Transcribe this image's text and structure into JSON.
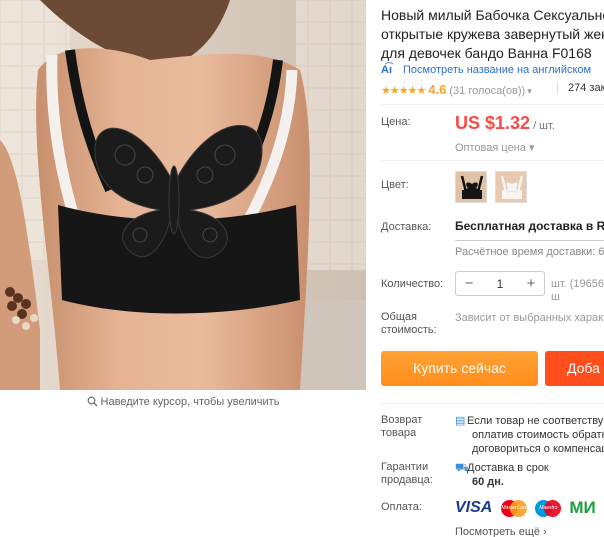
{
  "gallery": {
    "zoom_hint": "Наведите курсор, чтобы увеличить"
  },
  "product": {
    "title_lines": [
      "Новый милый Бабочка Сексуальное",
      "открытые кружева завернутый женс",
      "для девочек бандо Ванна F0168"
    ],
    "translate_link": "Посмотреть название на английском",
    "rating_stars": "★★★★★",
    "rating_value": "4.6",
    "votes": "(31 голоса(ов))",
    "orders": "274 зака"
  },
  "price": {
    "label": "Цена:",
    "value": "US $1.32",
    "unit": "/ шт.",
    "wholesale_link": "Оптовая цена ▾"
  },
  "color": {
    "label": "Цвет:"
  },
  "shipping": {
    "label": "Доставка:",
    "value": "Бесплатная доставка в Russi",
    "time": "Расчётное время доставки: 60"
  },
  "quantity": {
    "label": "Количество:",
    "minus": "−",
    "value": "1",
    "plus": "+",
    "note": "шт. (19656 ш"
  },
  "total": {
    "label_lines": [
      "Общая",
      "стоимость:"
    ],
    "value": "Зависит от выбранных характ"
  },
  "buttons": {
    "buy_now": "Купить сейчас",
    "add_to_cart": "Доба"
  },
  "returns": {
    "label_lines": [
      "Возврат",
      "товара"
    ],
    "text_lines": [
      "Если товар не соответству",
      "оплатив стоимость обратн",
      "договориться о компенсац"
    ]
  },
  "guarantee": {
    "label_lines": [
      "Гарантии",
      "продавца:"
    ],
    "text_lines": [
      "Доставка в срок",
      "60 дн."
    ]
  },
  "payment": {
    "label": "Оплата:",
    "visa": "VISA",
    "mastercard": "MasterCard",
    "maestro": "Maestro",
    "mir": "МИ",
    "more": "Посмотреть ещё ›"
  },
  "colors": {
    "price_red": "#ff4747",
    "buy_orange": "#ff9a2a",
    "cart_red": "#ff4e1c",
    "link_blue": "#2b6fd0",
    "star_gold": "#f5a623"
  }
}
